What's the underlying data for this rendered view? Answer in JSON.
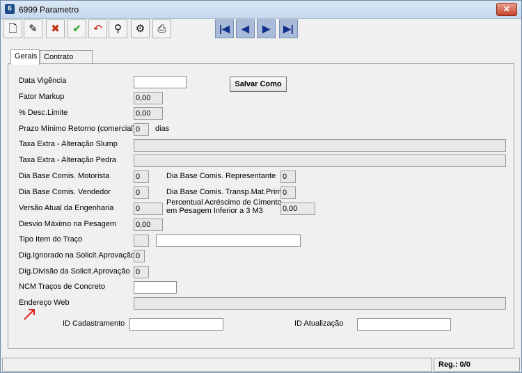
{
  "window": {
    "title": "6999 Parametro",
    "app_icon": "app-logo-icon",
    "close_label": "✕"
  },
  "toolbar": {
    "buttons": [
      {
        "name": "new-document-icon",
        "glyph": "🗋"
      },
      {
        "name": "edit-icon",
        "glyph": "✎"
      },
      {
        "name": "cancel-icon",
        "glyph": "✖"
      },
      {
        "name": "confirm-icon",
        "glyph": "✔"
      },
      {
        "name": "undo-icon",
        "glyph": "↶"
      },
      {
        "name": "search-binoculars-icon",
        "glyph": "⚲"
      },
      {
        "name": "tools-icon",
        "glyph": "⚙"
      },
      {
        "name": "print-icon",
        "glyph": "⎙"
      }
    ],
    "nav": [
      {
        "name": "first-record-icon",
        "glyph": "|◀"
      },
      {
        "name": "prev-record-icon",
        "glyph": "◀"
      },
      {
        "name": "next-record-icon",
        "glyph": "▶"
      },
      {
        "name": "last-record-icon",
        "glyph": "▶|"
      }
    ]
  },
  "tabs": [
    "Gerais",
    "Contrato WEB"
  ],
  "form": {
    "data_vigencia": {
      "label": "Data Vigência",
      "value": ""
    },
    "salvar_como": "Salvar Como",
    "fator_markup": {
      "label": "Fator Markup",
      "value": "0,00"
    },
    "desc_limite": {
      "label": "% Desc.Limite",
      "value": "0,00"
    },
    "prazo_minimo": {
      "label": "Prazo Mínimo Retorno (comercial)",
      "value": "0",
      "unit": "dias"
    },
    "taxa_slump": {
      "label": "Taxa Extra - Alteração Slump",
      "value": ""
    },
    "taxa_pedra": {
      "label": "Taxa Extra - Alteração Pedra",
      "value": ""
    },
    "dia_motorista": {
      "label": "Dia Base Comis. Motorista",
      "value": "0"
    },
    "dia_representante": {
      "label": "Dia Base Comis. Representante",
      "value": "0"
    },
    "dia_vendedor": {
      "label": "Dia Base Comis. Vendedor",
      "value": "0"
    },
    "dia_transp": {
      "label": "Dia Base Comis. Transp.Mat.Prima",
      "value": "0"
    },
    "versao_engenharia": {
      "label": "Versão Atual da Engenharia",
      "value": "0"
    },
    "percentual_cimento": {
      "label_line1": "Percentual Acréscimo de Cimento",
      "label_line2": "em Pesagem Inferior a 3 M3",
      "value": "0,00"
    },
    "desvio_maximo": {
      "label": "Desvio Máximo na Pesagem",
      "value": "0,00"
    },
    "tipo_item": {
      "label": "Tipo Item do Traço",
      "code": "",
      "desc": ""
    },
    "dig_ignorado": {
      "label": "Díg.Ignorado na Solicit.Aprovação",
      "value": "0"
    },
    "dig_divisao": {
      "label": "Díg.Divisão da Solicit.Aprovação",
      "value": "0"
    },
    "ncm": {
      "label": "NCM Traços de Concreto",
      "value": ""
    },
    "endereco_web": {
      "label": "Endereço Web",
      "value": ""
    },
    "id_cadastramento": {
      "label": "ID Cadastramento",
      "value": ""
    },
    "id_atualizacao": {
      "label": "ID Atualização",
      "value": ""
    }
  },
  "status": {
    "reg": "Reg.: 0/0"
  },
  "colors": {
    "arrow": "#e02020",
    "nav_bg": "#a9bbd8"
  }
}
